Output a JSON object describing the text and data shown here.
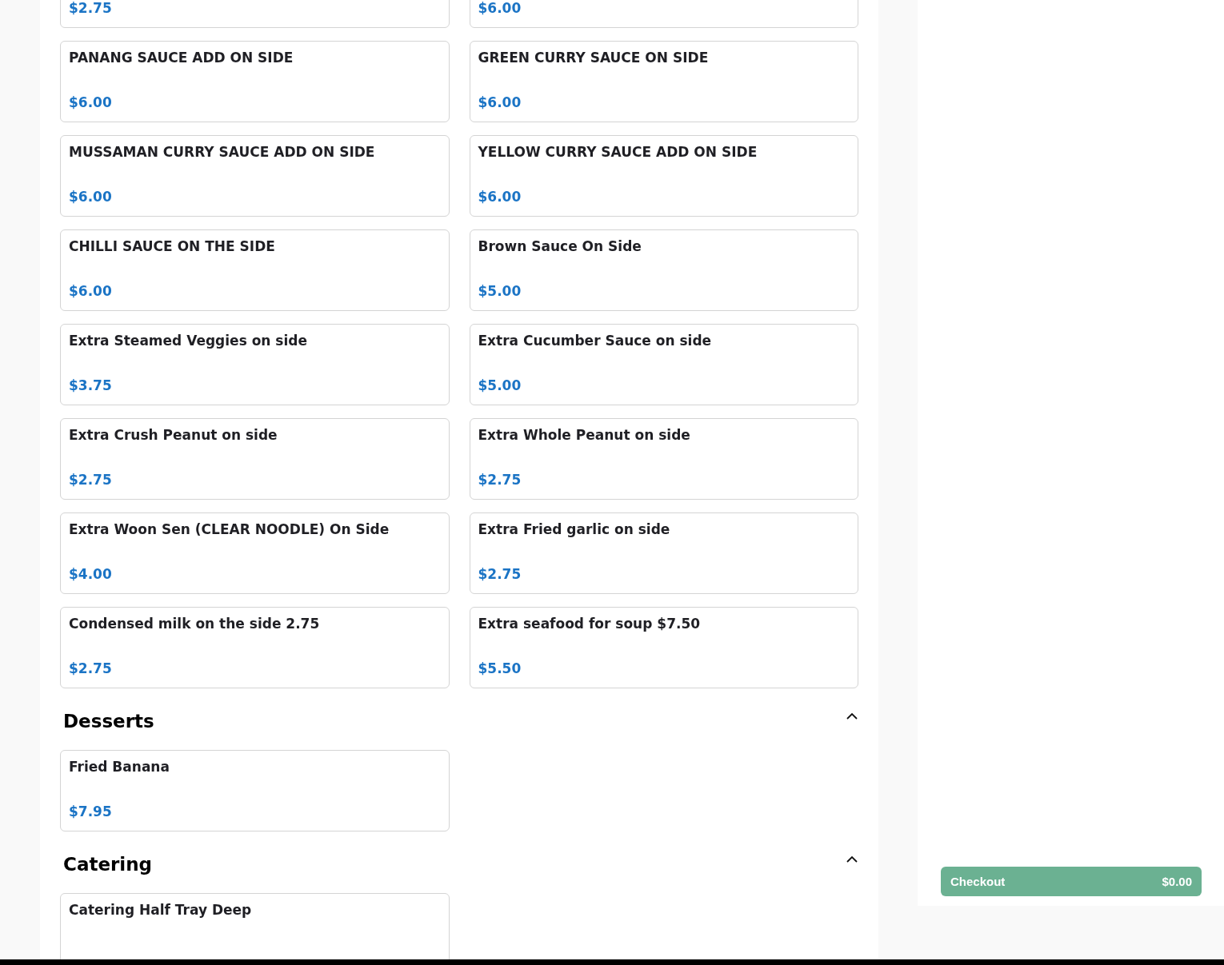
{
  "sections": [
    {
      "items": [
        {
          "price": "$2.75"
        },
        {
          "price": "$6.00"
        },
        {
          "name": "PANANG SAUCE ADD ON SIDE",
          "price": "$6.00"
        },
        {
          "name": "GREEN CURRY SAUCE ON SIDE",
          "price": "$6.00"
        },
        {
          "name": "MUSSAMAN CURRY SAUCE ADD ON SIDE",
          "price": "$6.00"
        },
        {
          "name": "YELLOW CURRY SAUCE ADD ON SIDE",
          "price": "$6.00"
        },
        {
          "name": "CHILLI SAUCE ON THE SIDE",
          "price": "$6.00"
        },
        {
          "name": "Brown Sauce On Side",
          "price": "$5.00"
        },
        {
          "name": "Extra Steamed Veggies on side",
          "price": "$3.75"
        },
        {
          "name": "Extra Cucumber Sauce on side",
          "price": "$5.00"
        },
        {
          "name": "Extra Crush Peanut on side",
          "price": "$2.75"
        },
        {
          "name": "Extra Whole Peanut on side",
          "price": "$2.75"
        },
        {
          "name": "Extra Woon Sen (CLEAR NOODLE) On Side",
          "price": "$4.00"
        },
        {
          "name": "Extra Fried garlic on side",
          "price": "$2.75"
        },
        {
          "name": "Condensed milk on the side 2.75",
          "price": "$2.75"
        },
        {
          "name": "Extra seafood for soup $7.50",
          "price": "$5.50"
        }
      ]
    },
    {
      "title": "Desserts",
      "expanded": true,
      "items": [
        {
          "name": "Fried Banana",
          "price": "$7.95"
        }
      ]
    },
    {
      "title": "Catering",
      "expanded": true,
      "items": [
        {
          "name": "Catering Half Tray Deep"
        }
      ]
    }
  ],
  "checkout": {
    "label": "Checkout",
    "total": "$0.00"
  }
}
